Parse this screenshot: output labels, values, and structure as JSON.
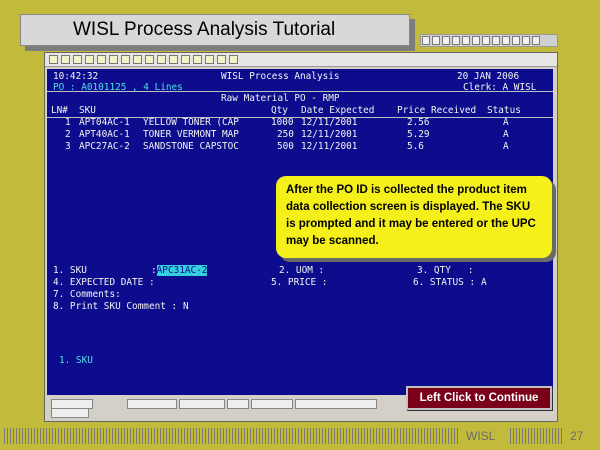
{
  "slide": {
    "title": "WISL Process Analysis Tutorial",
    "footer_brand": "WISL",
    "page_number": "27"
  },
  "terminal": {
    "time": "10:42:32",
    "app_title": "WISL Process Analysis",
    "date": "20 JAN 2006",
    "po_line": "PO : A0101125 , 4 Lines",
    "clerk_line": "Clerk: A WISL",
    "screen_title": "Raw Material PO - RMP",
    "columns": [
      "LN#",
      "SKU",
      "Qty",
      "Date Expected",
      "Price",
      "Received",
      "Status"
    ],
    "rows": [
      {
        "ln": "1",
        "sku": "APT04AC-1",
        "desc": "YELLOW TONER (CAP",
        "qty": "1000",
        "date": "12/11/2001",
        "price": "2.56",
        "status": "A"
      },
      {
        "ln": "2",
        "sku": "APT40AC-1",
        "desc": "TONER VERMONT MAP",
        "qty": "250",
        "date": "12/11/2001",
        "price": "5.29",
        "status": "A"
      },
      {
        "ln": "3",
        "sku": "APC27AC-2",
        "desc": "SANDSTONE CAPSTOC",
        "qty": "500",
        "date": "12/11/2001",
        "price": "5.6",
        "status": "A"
      }
    ],
    "fields": {
      "sku_label": "1. SKU",
      "sku_value": "APC31AC-2",
      "uom_label": "2. UOM :",
      "qty_label": "3. QTY   :",
      "expected_label": "4. EXPECTED DATE :",
      "price_label": "5. PRICE :",
      "status_label": "6. STATUS :",
      "status_value": "A",
      "comments_label": "7. Comments:",
      "print_label": "8. Print SKU Comment :",
      "print_value": "N"
    },
    "prompt": "1. SKU"
  },
  "callout": {
    "text": "After the PO ID is collected the product item data collection screen is displayed. The SKU is prompted and it may be entered or the UPC may be scanned."
  },
  "continue_button": "Left Click to Continue"
}
